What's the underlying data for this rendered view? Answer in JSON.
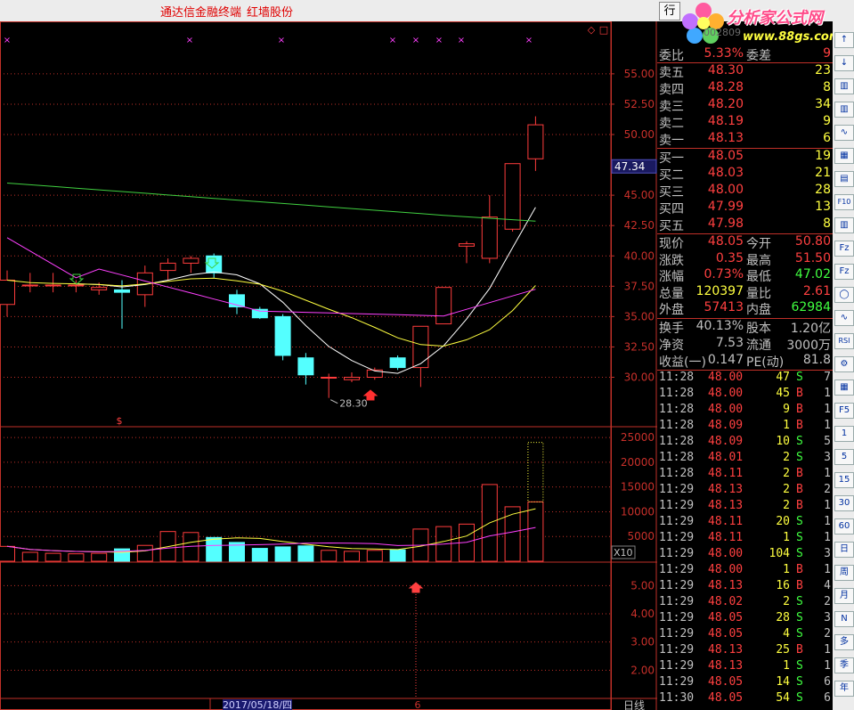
{
  "titlebar": {
    "app_name": "通达信金融终端",
    "stock_name": "红墙股份"
  },
  "top_button": "行",
  "logo": {
    "title": "分析家公式网",
    "url": "www.88gs.com",
    "partial_code": "002809"
  },
  "chart": {
    "price_ticks": [
      "55.00",
      "52.50",
      "50.00",
      "45.00",
      "42.50",
      "40.00",
      "37.50",
      "35.00",
      "32.50",
      "30.00"
    ],
    "current_price_tag": "47.34",
    "low_label": "28.30",
    "volume_ticks": [
      "25000",
      "20000",
      "15000",
      "10000",
      "5000"
    ],
    "volume_scale": "X10",
    "indicator_ticks": [
      "5.00",
      "4.00",
      "3.00",
      "2.00"
    ],
    "date_label": "2017/05/18/四",
    "date_marker": "6",
    "period_label": "日线",
    "dollar_mark": "$",
    "top_marks": [
      "×",
      "×",
      "×",
      "×",
      "×",
      "×",
      "×"
    ],
    "colors": {
      "up": "#ff3c3c",
      "down": "#54ffff",
      "ma_white": "#ffffff",
      "ma_yellow": "#ffff40",
      "ma_magenta": "#ff40ff",
      "ma_green": "#40d040",
      "grid": "#c03028"
    }
  },
  "chart_data": {
    "type": "candlestick",
    "candles": [
      {
        "o": 36.0,
        "h": 38.8,
        "l": 35.0,
        "c": 38.0
      },
      {
        "o": 37.6,
        "h": 38.6,
        "l": 37.0,
        "c": 37.6
      },
      {
        "o": 37.6,
        "h": 38.6,
        "l": 37.0,
        "c": 37.6
      },
      {
        "o": 37.6,
        "h": 38.0,
        "l": 37.0,
        "c": 37.6
      },
      {
        "o": 37.2,
        "h": 37.8,
        "l": 36.8,
        "c": 37.4
      },
      {
        "o": 37.2,
        "h": 38.0,
        "l": 34.0,
        "c": 37.0
      },
      {
        "o": 36.8,
        "h": 39.2,
        "l": 35.8,
        "c": 38.6
      },
      {
        "o": 38.8,
        "h": 39.8,
        "l": 38.0,
        "c": 39.4
      },
      {
        "o": 39.4,
        "h": 40.0,
        "l": 38.6,
        "c": 39.8
      },
      {
        "o": 40.0,
        "h": 40.2,
        "l": 38.2,
        "c": 38.6
      },
      {
        "o": 36.8,
        "h": 37.2,
        "l": 35.2,
        "c": 35.8
      },
      {
        "o": 35.6,
        "h": 35.8,
        "l": 34.8,
        "c": 34.9
      },
      {
        "o": 35.0,
        "h": 35.2,
        "l": 31.4,
        "c": 31.8
      },
      {
        "o": 31.6,
        "h": 32.0,
        "l": 29.4,
        "c": 30.2
      },
      {
        "o": 30.0,
        "h": 30.3,
        "l": 28.3,
        "c": 30.0
      },
      {
        "o": 29.8,
        "h": 30.4,
        "l": 29.6,
        "c": 30.0
      },
      {
        "o": 30.0,
        "h": 30.8,
        "l": 29.8,
        "c": 30.6
      },
      {
        "o": 31.6,
        "h": 31.8,
        "l": 30.6,
        "c": 30.8
      },
      {
        "o": 30.8,
        "h": 34.2,
        "l": 29.2,
        "c": 34.2
      },
      {
        "o": 34.4,
        "h": 37.4,
        "l": 34.4,
        "c": 37.4
      },
      {
        "o": 40.8,
        "h": 41.2,
        "l": 39.4,
        "c": 41.0
      },
      {
        "o": 39.8,
        "h": 45.0,
        "l": 39.4,
        "c": 43.2
      },
      {
        "o": 42.2,
        "h": 47.6,
        "l": 42.0,
        "c": 47.6
      },
      {
        "o": 48.0,
        "h": 51.5,
        "l": 47.0,
        "c": 50.8
      }
    ],
    "volume": [
      3000,
      1800,
      1600,
      1500,
      1600,
      2500,
      3200,
      6000,
      5800,
      4800,
      3800,
      2600,
      2900,
      3100,
      2200,
      2000,
      2200,
      2300,
      6500,
      7000,
      7500,
      15500,
      11000,
      12000
    ],
    "volume_total_last": 24000
  },
  "quote": {
    "weibi": {
      "label": "委比",
      "value": "5.33%",
      "label2": "委差",
      "value2": "9"
    },
    "sell": [
      {
        "label": "卖五",
        "price": "48.30",
        "vol": "23"
      },
      {
        "label": "卖四",
        "price": "48.28",
        "vol": "8"
      },
      {
        "label": "卖三",
        "price": "48.20",
        "vol": "34"
      },
      {
        "label": "卖二",
        "price": "48.19",
        "vol": "9"
      },
      {
        "label": "卖一",
        "price": "48.13",
        "vol": "6"
      }
    ],
    "buy": [
      {
        "label": "买一",
        "price": "48.05",
        "vol": "19"
      },
      {
        "label": "买二",
        "price": "48.03",
        "vol": "21"
      },
      {
        "label": "买三",
        "price": "48.00",
        "vol": "28"
      },
      {
        "label": "买四",
        "price": "47.99",
        "vol": "13"
      },
      {
        "label": "买五",
        "price": "47.98",
        "vol": "8"
      }
    ],
    "stats1": [
      {
        "l1": "现价",
        "v1": "48.05",
        "l2": "今开",
        "v2": "50.80"
      },
      {
        "l1": "涨跌",
        "v1": "0.35",
        "l2": "最高",
        "v2": "51.50"
      },
      {
        "l1": "涨幅",
        "v1": "0.73%",
        "l2": "最低",
        "v2": "47.02"
      },
      {
        "l1": "总量",
        "v1": "120397",
        "l2": "量比",
        "v2": "2.61"
      },
      {
        "l1": "外盘",
        "v1": "57413",
        "l2": "内盘",
        "v2": "62984"
      }
    ],
    "stats2": [
      {
        "l1": "换手",
        "v1": "40.13%",
        "l2": "股本",
        "v2": "1.20亿"
      },
      {
        "l1": "净资",
        "v1": "7.53",
        "l2": "流通",
        "v2": "3000万"
      },
      {
        "l1": "收益(一)",
        "v1": "0.147",
        "l2": "PE(动)",
        "v2": "81.8"
      }
    ],
    "trades": [
      {
        "t": "11:28",
        "p": "48.00",
        "v": "47",
        "s": "S",
        "n": "7"
      },
      {
        "t": "11:28",
        "p": "48.00",
        "v": "45",
        "s": "B",
        "n": "1"
      },
      {
        "t": "11:28",
        "p": "48.00",
        "v": "9",
        "s": "B",
        "n": "1"
      },
      {
        "t": "11:28",
        "p": "48.09",
        "v": "1",
        "s": "B",
        "n": "1"
      },
      {
        "t": "11:28",
        "p": "48.09",
        "v": "10",
        "s": "S",
        "n": "5"
      },
      {
        "t": "11:28",
        "p": "48.01",
        "v": "2",
        "s": "S",
        "n": "3"
      },
      {
        "t": "11:28",
        "p": "48.11",
        "v": "2",
        "s": "B",
        "n": "1"
      },
      {
        "t": "11:29",
        "p": "48.13",
        "v": "2",
        "s": "B",
        "n": "2"
      },
      {
        "t": "11:29",
        "p": "48.13",
        "v": "2",
        "s": "B",
        "n": "1"
      },
      {
        "t": "11:29",
        "p": "48.11",
        "v": "20",
        "s": "S",
        "n": "1"
      },
      {
        "t": "11:29",
        "p": "48.11",
        "v": "1",
        "s": "S",
        "n": "1"
      },
      {
        "t": "11:29",
        "p": "48.00",
        "v": "104",
        "s": "S",
        "n": "3"
      },
      {
        "t": "11:29",
        "p": "48.00",
        "v": "1",
        "s": "B",
        "n": "1"
      },
      {
        "t": "11:29",
        "p": "48.13",
        "v": "16",
        "s": "B",
        "n": "4"
      },
      {
        "t": "11:29",
        "p": "48.02",
        "v": "2",
        "s": "S",
        "n": "2"
      },
      {
        "t": "11:29",
        "p": "48.05",
        "v": "28",
        "s": "S",
        "n": "3"
      },
      {
        "t": "11:29",
        "p": "48.05",
        "v": "4",
        "s": "S",
        "n": "2"
      },
      {
        "t": "11:29",
        "p": "48.13",
        "v": "25",
        "s": "B",
        "n": "1"
      },
      {
        "t": "11:29",
        "p": "48.13",
        "v": "1",
        "s": "S",
        "n": "1"
      },
      {
        "t": "11:29",
        "p": "48.05",
        "v": "14",
        "s": "S",
        "n": "6"
      },
      {
        "t": "11:30",
        "p": "48.05",
        "v": "54",
        "s": "S",
        "n": "6"
      }
    ]
  },
  "side_toolbar": [
    "↑",
    "↓",
    "▥",
    "▥",
    "∿",
    "▦",
    "▤",
    "F10",
    "▥",
    "Fz",
    "Fz",
    "◯",
    "∿",
    "RSI",
    "⚙",
    "▦",
    "F5",
    "1",
    "5",
    "15",
    "30",
    "60",
    "日",
    "周",
    "月",
    "N",
    "多",
    "季",
    "年"
  ]
}
